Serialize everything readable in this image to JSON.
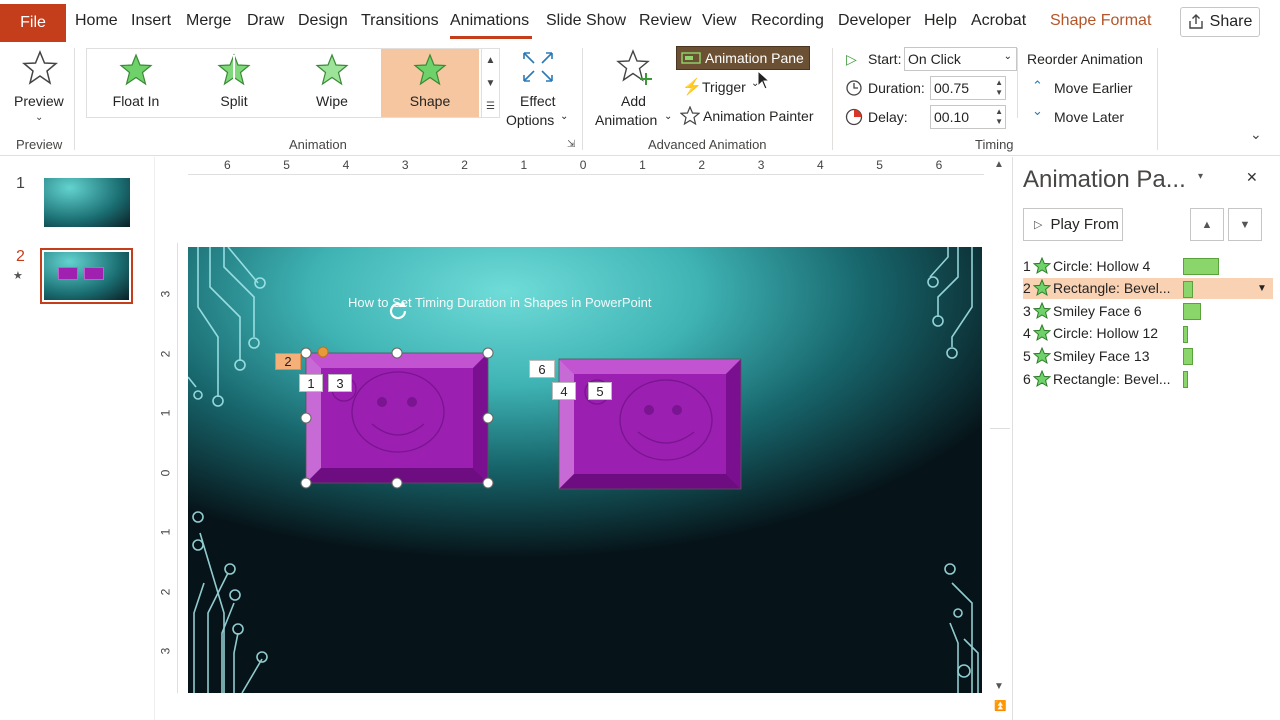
{
  "colors": {
    "accent": "#c43e1c",
    "selection": "#f5c6a0",
    "timeline_bar": "#8bd66a",
    "shape_purple": "#a020b0",
    "animation_pane_button": "#6b5033"
  },
  "tabs": {
    "file": "File",
    "home": "Home",
    "insert": "Insert",
    "merge": "Merge",
    "draw": "Draw",
    "design": "Design",
    "transitions": "Transitions",
    "animations": "Animations",
    "slideshow": "Slide Show",
    "review": "Review",
    "view": "View",
    "recording": "Recording",
    "developer": "Developer",
    "help": "Help",
    "acrobat": "Acrobat",
    "shape_format": "Shape Format",
    "share": "Share"
  },
  "ribbon": {
    "preview": {
      "label": "Preview",
      "group": "Preview"
    },
    "animation_group": "Animation",
    "gallery": [
      {
        "label": "Float In",
        "selected": false
      },
      {
        "label": "Split",
        "selected": false
      },
      {
        "label": "Wipe",
        "selected": false
      },
      {
        "label": "Shape",
        "selected": true
      }
    ],
    "effect_options_1": "Effect",
    "effect_options_2": "Options",
    "add_animation_1": "Add",
    "add_animation_2": "Animation",
    "animation_pane": "Animation Pane",
    "trigger": "Trigger",
    "animation_painter": "Animation Painter",
    "advanced_group": "Advanced Animation",
    "start_label": "Start:",
    "start_value": "On Click",
    "duration_label": "Duration:",
    "duration_value": "00.75",
    "delay_label": "Delay:",
    "delay_value": "00.10",
    "timing_group": "Timing",
    "reorder": "Reorder Animation",
    "move_earlier": "Move Earlier",
    "move_later": "Move Later"
  },
  "thumbnails": [
    {
      "number": "1"
    },
    {
      "number": "2",
      "has_animation": true
    }
  ],
  "rulers": {
    "horizontal": [
      "6",
      "5",
      "4",
      "3",
      "2",
      "1",
      "0",
      "1",
      "2",
      "3",
      "4",
      "5",
      "6"
    ],
    "vertical": [
      "3",
      "2",
      "1",
      "0",
      "1",
      "2",
      "3"
    ]
  },
  "slide": {
    "title": "How to Set Timing Duration in Shapes in PowerPoint",
    "tags": {
      "t2": "2",
      "t1": "1",
      "t3": "3",
      "t6": "6",
      "t4": "4",
      "t5": "5"
    }
  },
  "animation_pane": {
    "title": "Animation Pa...",
    "play_from": "Play From",
    "items": [
      {
        "num": "1",
        "label": "Circle: Hollow 4",
        "bar": 0.75,
        "selected": false
      },
      {
        "num": "2",
        "label": "Rectangle: Bevel...",
        "bar": 0.2,
        "selected": true
      },
      {
        "num": "3",
        "label": "Smiley Face 6",
        "bar": 0.38,
        "selected": false
      },
      {
        "num": "4",
        "label": "Circle: Hollow 12",
        "bar": 0.1,
        "selected": false
      },
      {
        "num": "5",
        "label": "Smiley Face 13",
        "bar": 0.2,
        "selected": false
      },
      {
        "num": "6",
        "label": "Rectangle: Bevel...",
        "bar": 0.1,
        "selected": false
      }
    ]
  }
}
